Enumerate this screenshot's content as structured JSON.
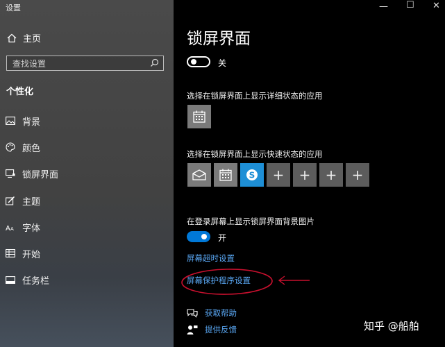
{
  "window": {
    "title": "设置",
    "minimize": "—",
    "maximize": "☐",
    "close": "✕"
  },
  "sidebar": {
    "home_label": "主页",
    "search_placeholder": "查找设置",
    "section_title": "个性化",
    "items": [
      {
        "label": "背景",
        "icon": "picture-icon"
      },
      {
        "label": "颜色",
        "icon": "palette-icon"
      },
      {
        "label": "锁屏界面",
        "icon": "lockscreen-icon"
      },
      {
        "label": "主题",
        "icon": "brush-icon"
      },
      {
        "label": "字体",
        "icon": "font-icon"
      },
      {
        "label": "开始",
        "icon": "start-icon"
      },
      {
        "label": "任务栏",
        "icon": "taskbar-icon"
      }
    ]
  },
  "main": {
    "title": "锁屏界面",
    "toggle1_label": "关",
    "detailed_status_text": "选择在锁屏界面上显示详细状态的应用",
    "quick_status_text": "选择在锁屏界面上显示快速状态的应用",
    "add_symbol": "+",
    "skype_letter": "S",
    "show_bg_text": "在登录屏幕上显示锁屏界面背景图片",
    "toggle2_label": "开",
    "timeout_link": "屏幕超时设置",
    "screensaver_link": "屏幕保护程序设置",
    "help_label": "获取帮助",
    "feedback_label": "提供反馈"
  },
  "watermark": "知乎 @船舶",
  "colors": {
    "accent": "#0078d7",
    "link": "#5aa8f5",
    "annotation": "#c8102e",
    "sidebar_bg": "#454545"
  }
}
